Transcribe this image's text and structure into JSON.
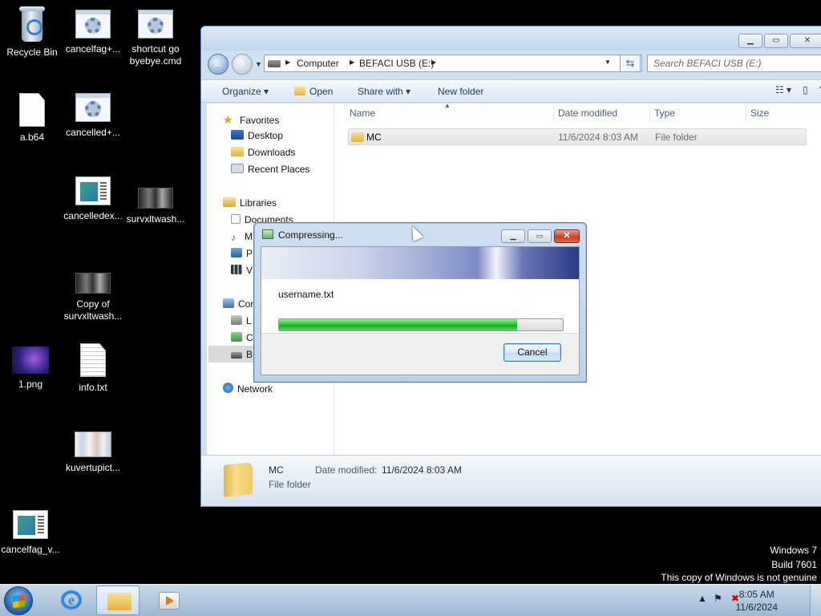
{
  "desktop": {
    "icons": [
      {
        "label": "Recycle Bin",
        "icon": "recycle-bin-icon"
      },
      {
        "label": "cancelfag+...",
        "icon": "script-icon"
      },
      {
        "label": "shortcut go byebye.cmd",
        "icon": "script-icon"
      },
      {
        "label": "a.b64",
        "icon": "file-icon"
      },
      {
        "label": "cancelled+...",
        "icon": "script-icon"
      },
      {
        "label": "cancelledex...",
        "icon": "app-thumbnail-icon"
      },
      {
        "label": "survxltwash...",
        "icon": "image-thumbnail-icon"
      },
      {
        "label": "Copy of survxltwash...",
        "icon": "image-thumbnail-icon"
      },
      {
        "label": "1.png",
        "icon": "image-thumbnail-icon"
      },
      {
        "label": "info.txt",
        "icon": "text-file-icon"
      },
      {
        "label": "kuvertupict...",
        "icon": "image-thumbnail-icon"
      },
      {
        "label": "cancelfag_v...",
        "icon": "app-thumbnail-icon"
      }
    ]
  },
  "explorer": {
    "address": {
      "crumbs": [
        "Computer",
        "BEFACI USB (E:)"
      ],
      "search_placeholder": "Search BEFACI USB (E:)"
    },
    "commands": [
      "Organize",
      "Open",
      "Share with",
      "New folder"
    ],
    "nav": {
      "favorites_header": "Favorites",
      "favorites": [
        "Desktop",
        "Downloads",
        "Recent Places"
      ],
      "libraries_header": "Libraries",
      "libraries": [
        "Documents",
        "M",
        "P",
        "V"
      ],
      "computer_header": "Cor",
      "computer_items": [
        "L",
        "C",
        "B"
      ],
      "network": "Network"
    },
    "columns": [
      "Name",
      "Date modified",
      "Type",
      "Size"
    ],
    "files": [
      {
        "name": "MC",
        "date": "11/6/2024 8:03 AM",
        "type": "File folder",
        "size": ""
      }
    ],
    "details": {
      "name": "MC",
      "date_label": "Date modified:",
      "date": "11/6/2024 8:03 AM",
      "type": "File folder"
    }
  },
  "dialog": {
    "title": "Compressing...",
    "file": "username.txt",
    "progress": 0.84,
    "cancel_label": "Cancel"
  },
  "watermark": {
    "line1": "Windows 7",
    "line2": "Build 7601",
    "line3": "This copy of Windows is not genuine"
  },
  "taskbar": {
    "time": "8:05 AM",
    "date": "11/6/2024",
    "pinned": [
      "internet-explorer-icon",
      "windows-explorer-icon",
      "media-player-icon"
    ]
  }
}
